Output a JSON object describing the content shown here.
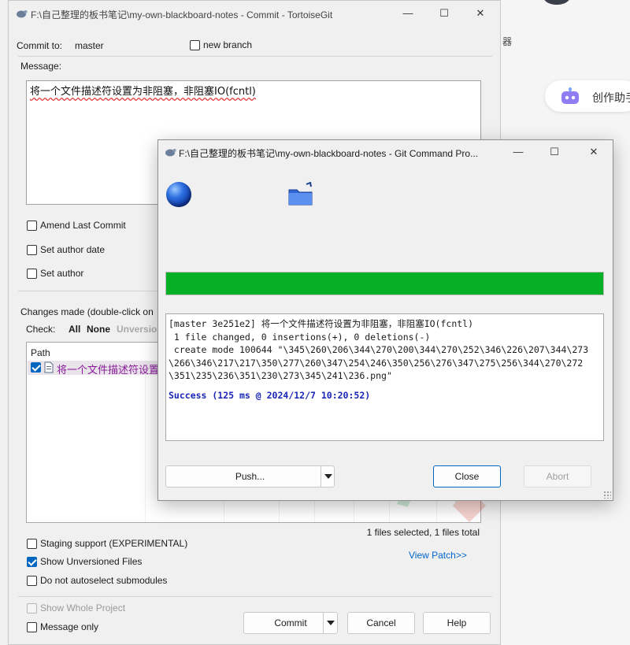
{
  "commit_window": {
    "title": "F:\\自己整理的板书笔记\\my-own-blackboard-notes - Commit - TortoiseGit",
    "commit_to_label": "Commit to:",
    "branch": "master",
    "new_branch_label": "new branch",
    "message_label": "Message:",
    "message_text": "将一个文件描述符设置为非阻塞，非阻塞IO(fcntl)",
    "amend_label": "Amend Last Commit",
    "set_author_date_label": "Set author date",
    "set_author_label": "Set author",
    "changes_label": "Changes made (double-click on",
    "check_label": "Check:",
    "check_all": "All",
    "check_none": "None",
    "check_unversioned": "Unversio",
    "path_header": "Path",
    "file_row": "将一个文件描述符设置",
    "files_status": "1 files selected, 1 files total",
    "staging_label": "Staging support (EXPERIMENTAL)",
    "show_unversioned_label": "Show Unversioned Files",
    "no_autoselect_label": "Do not autoselect submodules",
    "view_patch": "View Patch>>",
    "show_whole_project_label": "Show Whole Project",
    "message_only_label": "Message only",
    "commit_button": "Commit",
    "cancel_button": "Cancel",
    "help_button": "Help"
  },
  "progress_dialog": {
    "title": "F:\\自己整理的板书笔记\\my-own-blackboard-notes - Git Command Pro...",
    "progress": 1.0,
    "log_lines": [
      "[master 3e251e2] 将一个文件描述符设置为非阻塞，非阻塞IO(fcntl)",
      " 1 file changed, 0 insertions(+), 0 deletions(-)",
      " create mode 100644 \"\\345\\260\\206\\344\\270\\200\\344\\270\\252\\346\\226\\207\\344\\273",
      "\\266\\346\\217\\217\\350\\277\\260\\347\\254\\246\\350\\256\\276\\347\\275\\256\\344\\270\\272",
      "\\351\\235\\236\\351\\230\\273\\345\\241\\236.png\""
    ],
    "success_text": "Success (125 ms @ 2024/12/7 10:20:52)",
    "push_button": "Push...",
    "close_button": "Close",
    "abort_button": "Abort"
  },
  "background": {
    "assist_text": "创作助手",
    "side_char": "器"
  },
  "colors": {
    "progress_green": "#06b025",
    "accent_blue": "#0067c0",
    "success_blue": "#1a26b8",
    "link_blue": "#0066cc"
  }
}
